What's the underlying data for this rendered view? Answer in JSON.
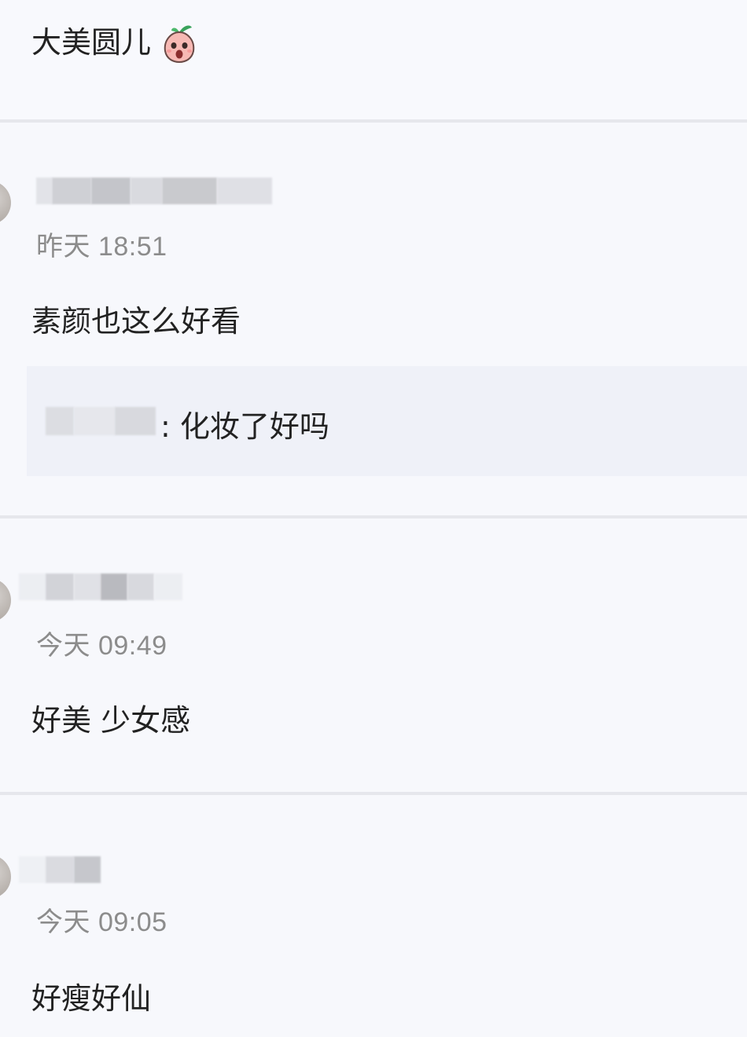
{
  "top_comment": {
    "text": "大美圆儿"
  },
  "comments": [
    {
      "time": "昨天 18:51",
      "text": "素颜也这么好看",
      "reply": {
        "text": ": 化妆了好吗"
      }
    },
    {
      "time": "今天 09:49",
      "text": "好美 少女感"
    },
    {
      "time": "今天 09:05",
      "text": "好瘦好仙"
    }
  ],
  "colors": {
    "background": "#f7f8fc",
    "divider": "#e6e7ec",
    "time": "#8c8c8c",
    "text": "#222222",
    "reply_background": "#eff1f8"
  },
  "icons": {
    "top_emoji": "surprised-radish-emoji-icon"
  }
}
